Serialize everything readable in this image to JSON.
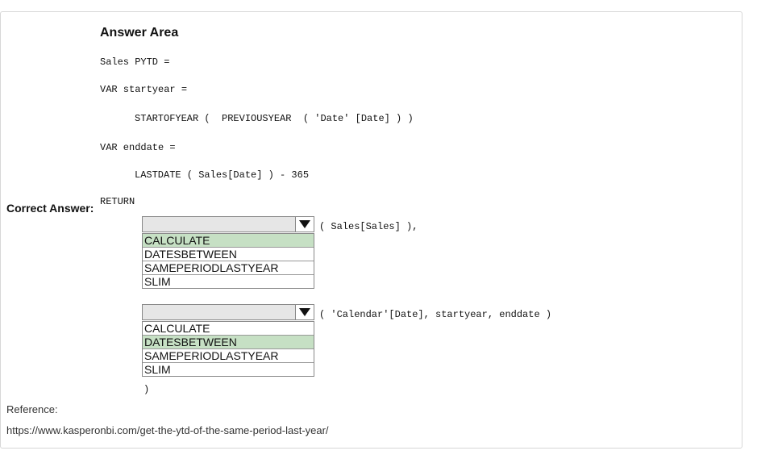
{
  "answer_area_title": "Answer Area",
  "correct_answer_label": "Correct Answer:",
  "code": {
    "line1": "Sales PYTD =",
    "line2": "VAR startyear =",
    "line3": "STARTOFYEAR (  PREVIOUSYEAR  ( 'Date' [Date] ) )",
    "line4": "VAR enddate =",
    "line5": "LASTDATE ( Sales[Date] ) - 365",
    "line6": "RETURN",
    "after_dropdown1": "( Sales[Sales] ),",
    "after_dropdown2": "( 'Calendar'[Date], startyear, enddate )",
    "closing": ")"
  },
  "dropdown1": {
    "options": [
      "CALCULATE",
      "DATESBETWEEN",
      "SAMEPERIODLASTYEAR",
      "SLIM"
    ],
    "selected_index": 0
  },
  "dropdown2": {
    "options": [
      "CALCULATE",
      "DATESBETWEEN",
      "SAMEPERIODLASTYEAR",
      "SLIM"
    ],
    "selected_index": 1
  },
  "reference": {
    "label": "Reference:",
    "url": "https://www.kasperonbi.com/get-the-ytd-of-the-same-period-last-year/"
  },
  "colors": {
    "selected_option_bg": "#c6e0c4",
    "dropdown_header_bg": "#e6e6e6"
  }
}
